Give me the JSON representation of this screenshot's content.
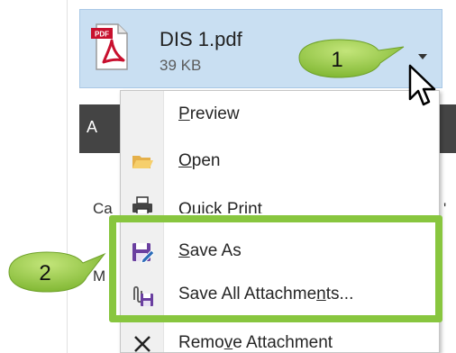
{
  "attachment": {
    "file_name": "DIS 1.pdf",
    "file_size": "39 KB",
    "icon_badge": "PDF",
    "icon": "pdf-file-icon"
  },
  "background": {
    "tab_letter": "A",
    "text_ca": "Ca",
    "text_m": "M",
    "text_comma": "'"
  },
  "menu": {
    "items": [
      {
        "pre": "",
        "key": "P",
        "post": "review",
        "icon": ""
      },
      {
        "pre": "",
        "key": "O",
        "post": "pen",
        "icon": "folder-open-icon"
      },
      {
        "pre": "",
        "key": "Q",
        "post": "uick Print",
        "icon": "printer-icon"
      },
      {
        "pre": "",
        "key": "S",
        "post": "ave As",
        "icon": "save-as-icon"
      },
      {
        "pre": "Save All Attachme",
        "key": "n",
        "post": "ts...",
        "icon": "save-all-attachments-icon"
      },
      {
        "pre": "Remo",
        "key": "v",
        "post": "e Attachment",
        "icon": "remove-x-icon"
      }
    ]
  },
  "callouts": {
    "step1": "1",
    "step2": "2"
  },
  "colors": {
    "attachment_bg": "#c9dff2",
    "callout_green": "#8dc63f",
    "highlight_green": "#88c63f",
    "pdf_red": "#c8102e"
  }
}
